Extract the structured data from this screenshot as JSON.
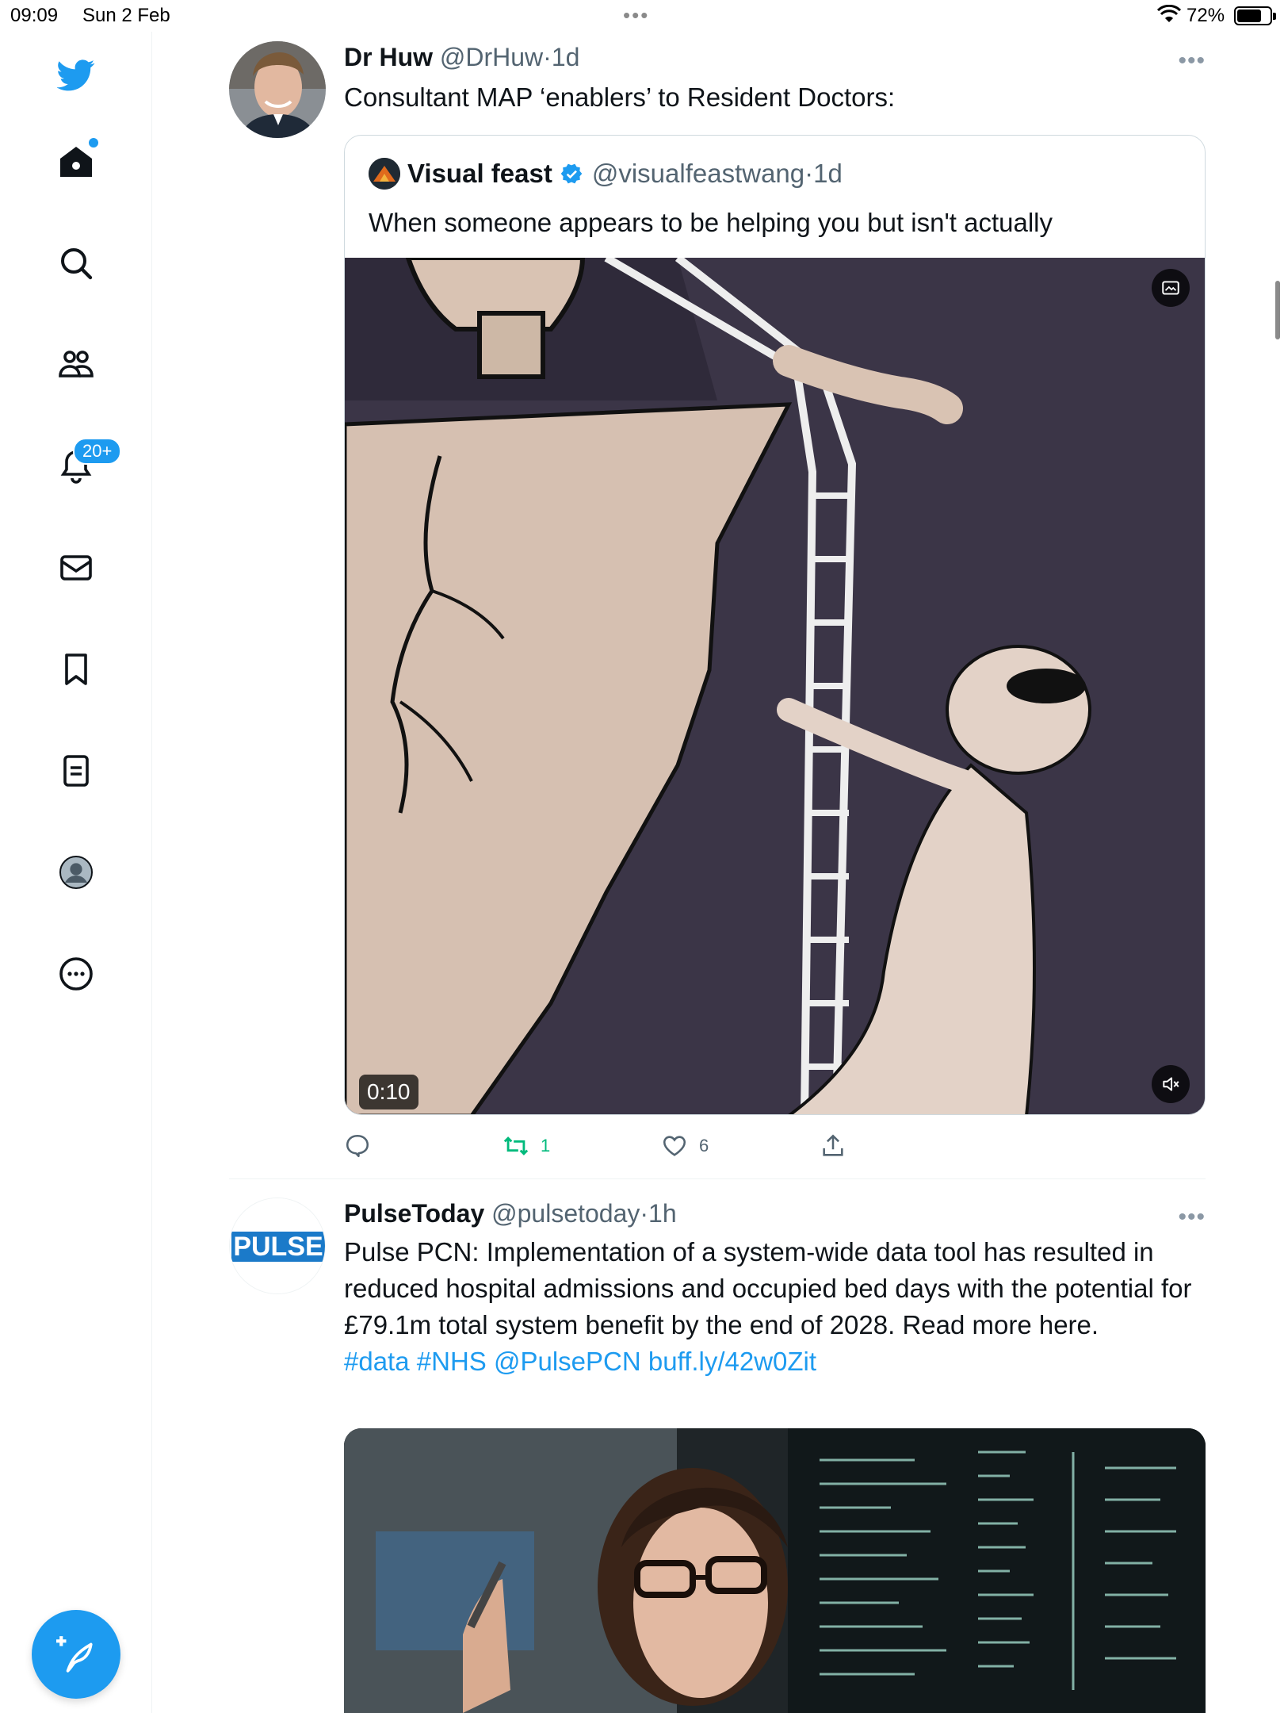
{
  "status_bar": {
    "time": "09:09",
    "date": "Sun 2 Feb",
    "battery": "72%"
  },
  "sidebar": {
    "items": [
      {
        "name": "twitter-logo"
      },
      {
        "name": "home"
      },
      {
        "name": "explore"
      },
      {
        "name": "communities"
      },
      {
        "name": "notifications",
        "badge": "20+"
      },
      {
        "name": "messages"
      },
      {
        "name": "bookmarks"
      },
      {
        "name": "lists"
      },
      {
        "name": "profile"
      },
      {
        "name": "more"
      }
    ],
    "accent": "#1d9bf0"
  },
  "tweets": [
    {
      "name": "Dr Huw",
      "handle": "@DrHuw",
      "sep": "·",
      "age": "1d",
      "text": "Consultant MAP ‘enablers’ to Resident Doctors:",
      "quote": {
        "name": "Visual feast",
        "handle": "@visualfeastwang",
        "sep": "·",
        "age": "1d",
        "text": "When someone appears to be helping you but isn't actually",
        "video_time": "0:10"
      },
      "actions": {
        "replies": "",
        "retweets": "1",
        "likes": "6"
      }
    },
    {
      "name": "PulseToday",
      "handle": "@pulsetoday",
      "sep": "·",
      "age": "1h",
      "avatar_text": "PULSE",
      "text": "Pulse PCN:  Implementation of a system-wide data tool has resulted in reduced hospital admissions and occupied bed days with the potential for £79.1m total system benefit by the end of 2028. Read more here.",
      "links": [
        "#data",
        "#NHS",
        "@PulsePCN",
        "buff.ly/42w0Zit"
      ]
    }
  ],
  "colors": {
    "retweet_active": "#00ba7c",
    "link": "#1d9bf0",
    "muted": "#536471"
  }
}
